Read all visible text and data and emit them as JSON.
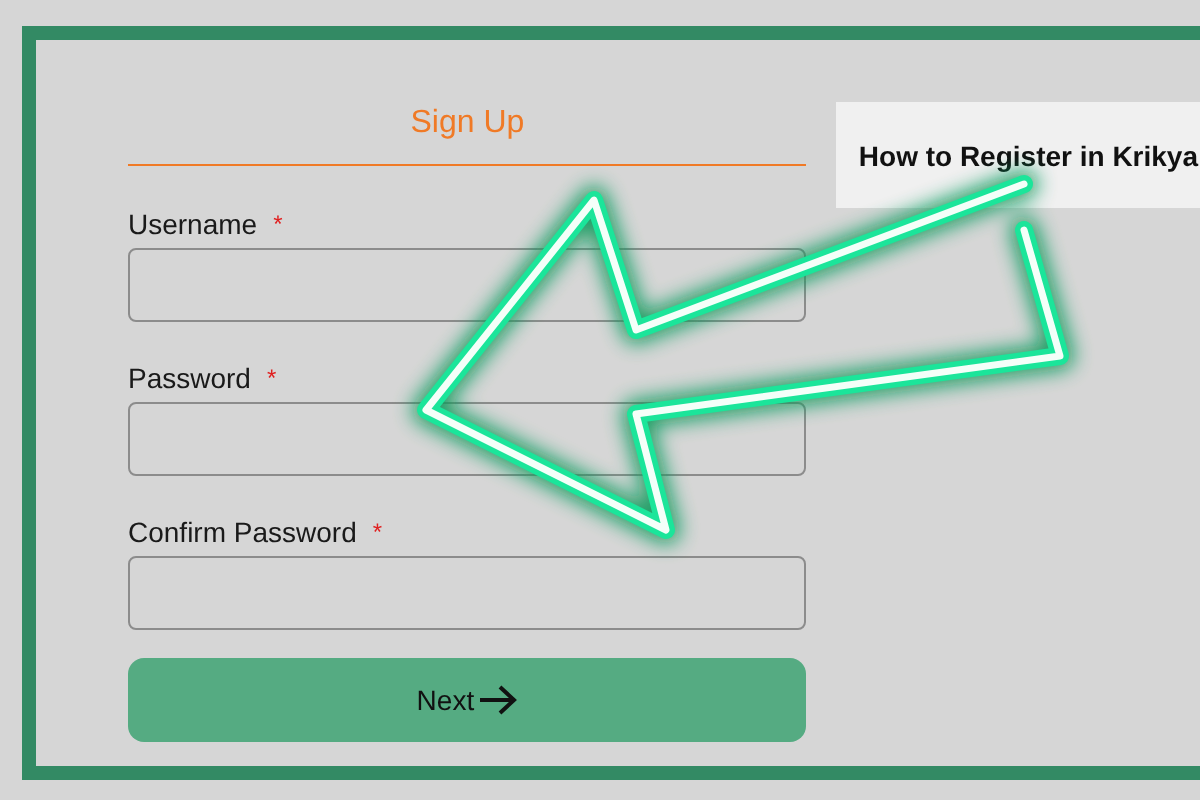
{
  "form": {
    "title": "Sign Up",
    "fields": [
      {
        "label": "Username",
        "required_mark": "*"
      },
      {
        "label": "Password",
        "required_mark": "*"
      },
      {
        "label": "Confirm Password",
        "required_mark": "*"
      }
    ],
    "button": "Next"
  },
  "side_card": {
    "heading": "How to Register in Krikya"
  }
}
